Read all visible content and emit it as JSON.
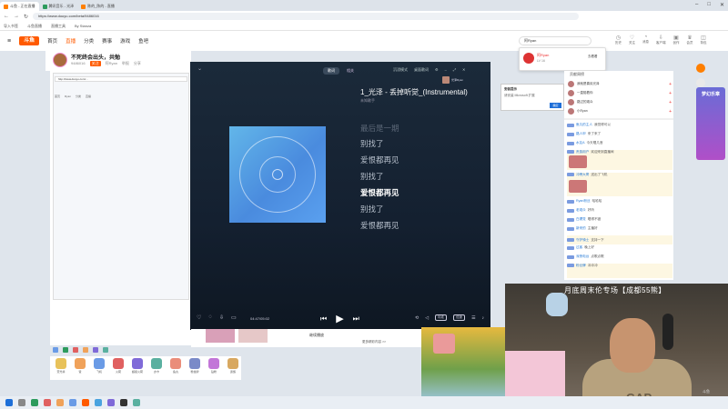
{
  "browser": {
    "tabs": [
      {
        "label": "斗鱼 - 正在直播"
      },
      {
        "label": "腾讯音乐 - 光泽"
      },
      {
        "label": "陈的_陈的 - 直播"
      }
    ],
    "url": "https://www.douyu.com/beta/9486016",
    "bookmarks": [
      "导入书签",
      "斗鱼直播",
      "直播工具",
      "By Stanza"
    ]
  },
  "douyu": {
    "logo": "斗鱼",
    "nav": [
      "首页",
      "直播",
      "分类",
      "赛事",
      "游戏",
      "鱼吧"
    ],
    "search_value": "阿Ryan",
    "header_icons": [
      "历史",
      "关注",
      "消息",
      "客户端",
      "创作",
      "会员",
      "背包"
    ]
  },
  "room": {
    "title": "不死终会出头，共勉",
    "id": "9486016",
    "follow": "关注",
    "meta": [
      "阿Ryan",
      "举报",
      "分享",
      "更多"
    ]
  },
  "inner_browser": {
    "url": "http://www.douyu.com/...",
    "tabs": [
      "首页",
      "Ryan",
      "分类",
      "直播"
    ]
  },
  "player": {
    "tabs": [
      "歌词",
      "相关"
    ],
    "controls": [
      "沉浸模式",
      "桌面歌词"
    ],
    "song_title": "1_光泽 - 丢掉听觉_(Instrumental)",
    "artist": "未知歌手",
    "lyrics": [
      {
        "text": "最后是一期",
        "state": "faded"
      },
      {
        "text": "别找了",
        "state": "normal"
      },
      {
        "text": "爱恨都再见",
        "state": "normal"
      },
      {
        "text": "别找了",
        "state": "normal"
      },
      {
        "text": "爱恨都再见",
        "state": "active"
      },
      {
        "text": "别找了",
        "state": "normal"
      },
      {
        "text": "爱恨都再见",
        "state": "normal"
      }
    ],
    "time": "04:47/05:02",
    "quality": "标准",
    "speed": "倍速",
    "popup_title": "安装提示",
    "popup_text": "请安装 Microsoft 扩展",
    "popup_button": "确定",
    "mini_user": "光泽Ryan"
  },
  "strip": {
    "button": "继续播放",
    "note": "更多精彩内容 >>"
  },
  "gifts": [
    {
      "name": "荧光棒",
      "color": "#e8c25a"
    },
    {
      "name": "赞",
      "color": "#f0a25a"
    },
    {
      "name": "飞机",
      "color": "#6a9be6"
    },
    {
      "name": "火箭",
      "color": "#e06060"
    },
    {
      "name": "超级火箭",
      "color": "#7f6ad8"
    },
    {
      "name": "办卡",
      "color": "#5ab0a0"
    },
    {
      "name": "鱼丸",
      "color": "#ea8d7a"
    },
    {
      "name": "粉丝牌",
      "color": "#7a8ac8"
    },
    {
      "name": "钻粉",
      "color": "#c276d8"
    },
    {
      "name": "贵族",
      "color": "#d8a860"
    }
  ],
  "footnote": "主播·9486016",
  "user_card": {
    "name": "阿Ryan",
    "level": "LV 16",
    "button": "去看看"
  },
  "chat": {
    "title": "贡献周榜",
    "ranks": [
      {
        "name": "我就是喜欢光泽",
        "plus": "+"
      },
      {
        "name": "一直陪着你",
        "plus": "+"
      },
      {
        "name": "路过的观众",
        "plus": "+"
      },
      {
        "name": "小Ryan",
        "plus": "+"
      }
    ],
    "messages": [
      {
        "user": "鱼丸的主人",
        "text": "我觉得可以",
        "hl": false
      },
      {
        "user": "路人甲",
        "text": "来了来了",
        "hl": false
      },
      {
        "user": "水友A",
        "text": "今天唱几首",
        "hl": false
      },
      {
        "user": "贵族用户",
        "text": "欢迎来到直播间",
        "hl": true
      },
      {
        "user": "冲榜大哥",
        "text": "送出了飞机",
        "hl": true
      },
      {
        "user": "Ryan粉丝",
        "text": "哈哈哈",
        "hl": false
      },
      {
        "user": "老观众",
        "text": "好听",
        "hl": false
      },
      {
        "user": "白嫖党",
        "text": "唱得不错",
        "hl": false
      },
      {
        "user": "新来的",
        "text": "主播好",
        "hl": false
      },
      {
        "user": "守护骑士",
        "text": "支持一下",
        "hl": true
      },
      {
        "user": "过客",
        "text": "晚上好",
        "hl": false
      },
      {
        "user": "深夜电台",
        "text": "点歌点歌",
        "hl": false
      },
      {
        "user": "粉丝牌",
        "text": "冲冲冲",
        "hl": true
      }
    ]
  },
  "ad": {
    "text": "梦幻乐章"
  },
  "cam": {
    "title": "月底周末伦专场【成都55熊】",
    "shirt": "GAP",
    "logo": "斗鱼"
  }
}
